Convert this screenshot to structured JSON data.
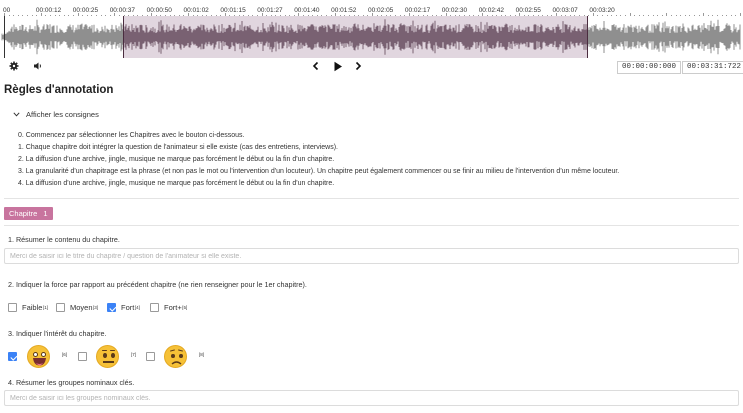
{
  "timeline": {
    "labels": [
      "00",
      "00:00:12",
      "00:00:25",
      "00:00:37",
      "00:00:50",
      "00:01:02",
      "00:01:15",
      "00:01:27",
      "00:01:40",
      "00:01:52",
      "00:02:05",
      "00:02:17",
      "00:02:30",
      "00:02:42",
      "00:02:55",
      "00:03:07",
      "00:03:20"
    ]
  },
  "player": {
    "current_time": "00:00:00:000",
    "total_time": "00:03:31:722",
    "settings_icon": "gear-icon",
    "volume_icon": "speaker-icon",
    "prev_icon": "chevron-left-icon",
    "play_icon": "play-icon",
    "next_icon": "chevron-right-icon"
  },
  "page": {
    "title": "Règles d'annotation",
    "consignes_toggle": "Afficher les consignes"
  },
  "instructions": [
    "0. Commencez par sélectionner les Chapitres avec le bouton ci-dessous.",
    "1. Chaque chapitre doit intégrer la question de l'animateur si elle existe (cas des entretiens, interviews).",
    "2. La diffusion d'une archive, jingle, musique ne marque pas forcément le début ou la fin d'un chapitre.",
    "3. La granularité d'un chapitrage est la phrase (et non pas le mot ou l'intervention d'un locuteur). Un chapitre peut également commencer ou se finir au milieu de l'intervention d'un même locuteur.",
    "4. La diffusion d'une archive, jingle, musique ne marque pas forcément le début ou la fin d'un chapitre."
  ],
  "chapter": {
    "label": "Chapitre",
    "number": "1",
    "color": "#c8749e"
  },
  "questions": {
    "q1": {
      "label": "1. Résumer le contenu du chapitre.",
      "placeholder": "Merci de saisir ici le titre du chapitre / question de l'animateur si elle existe."
    },
    "q2": {
      "label": "2. Indiquer la force par rapport au précédent chapitre (ne rien renseigner pour le 1er chapitre).",
      "options": [
        {
          "label": "Faible",
          "sup": "[1]",
          "checked": false
        },
        {
          "label": "Moyen",
          "sup": "[3]",
          "checked": false
        },
        {
          "label": "Fort",
          "sup": "[4]",
          "checked": true
        },
        {
          "label": "Fort+",
          "sup": "[5]",
          "checked": false
        }
      ]
    },
    "q3": {
      "label": "3. Indiquer l'intérêt du chapitre.",
      "options": [
        {
          "icon": "smiling-face-icon",
          "sup": "[6]",
          "checked": true
        },
        {
          "icon": "neutral-face-icon",
          "sup": "[7]",
          "checked": false
        },
        {
          "icon": "frowning-face-icon",
          "sup": "[8]",
          "checked": false
        }
      ]
    },
    "q4": {
      "label": "4. Résumer les groupes nominaux clés.",
      "placeholder": "Merci de saisir ici les groupes nominaux clés."
    }
  },
  "colors": {
    "accent": "#3b82f6",
    "waveform": "#8f8f8f",
    "waveform_region": "#7a6a74",
    "region_fill": "#d8c6d2"
  }
}
